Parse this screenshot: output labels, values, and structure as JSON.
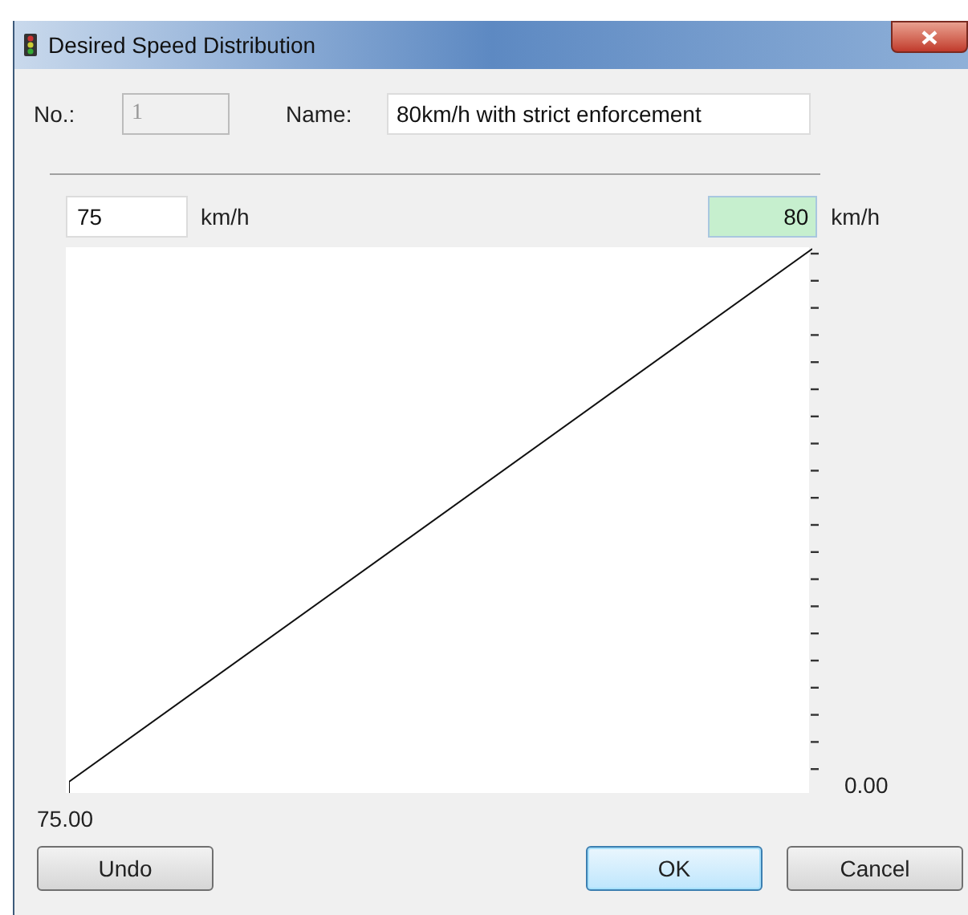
{
  "window": {
    "title": "Desired Speed Distribution"
  },
  "number_field": {
    "label": "No.:",
    "value": "1",
    "disabled": true
  },
  "name_field": {
    "label": "Name:",
    "value": "80km/h with strict enforcement"
  },
  "min_speed": {
    "value": "75",
    "unit": "km/h"
  },
  "max_speed": {
    "value": "80",
    "unit": "km/h",
    "highlighted": true
  },
  "plot": {
    "x_axis_label": "75.00",
    "y_axis_label": "0.00"
  },
  "buttons": [
    {
      "label": "Undo",
      "kind": "plain"
    },
    {
      "label": "OK",
      "kind": "default"
    },
    {
      "label": "Cancel",
      "kind": "plain"
    }
  ]
}
